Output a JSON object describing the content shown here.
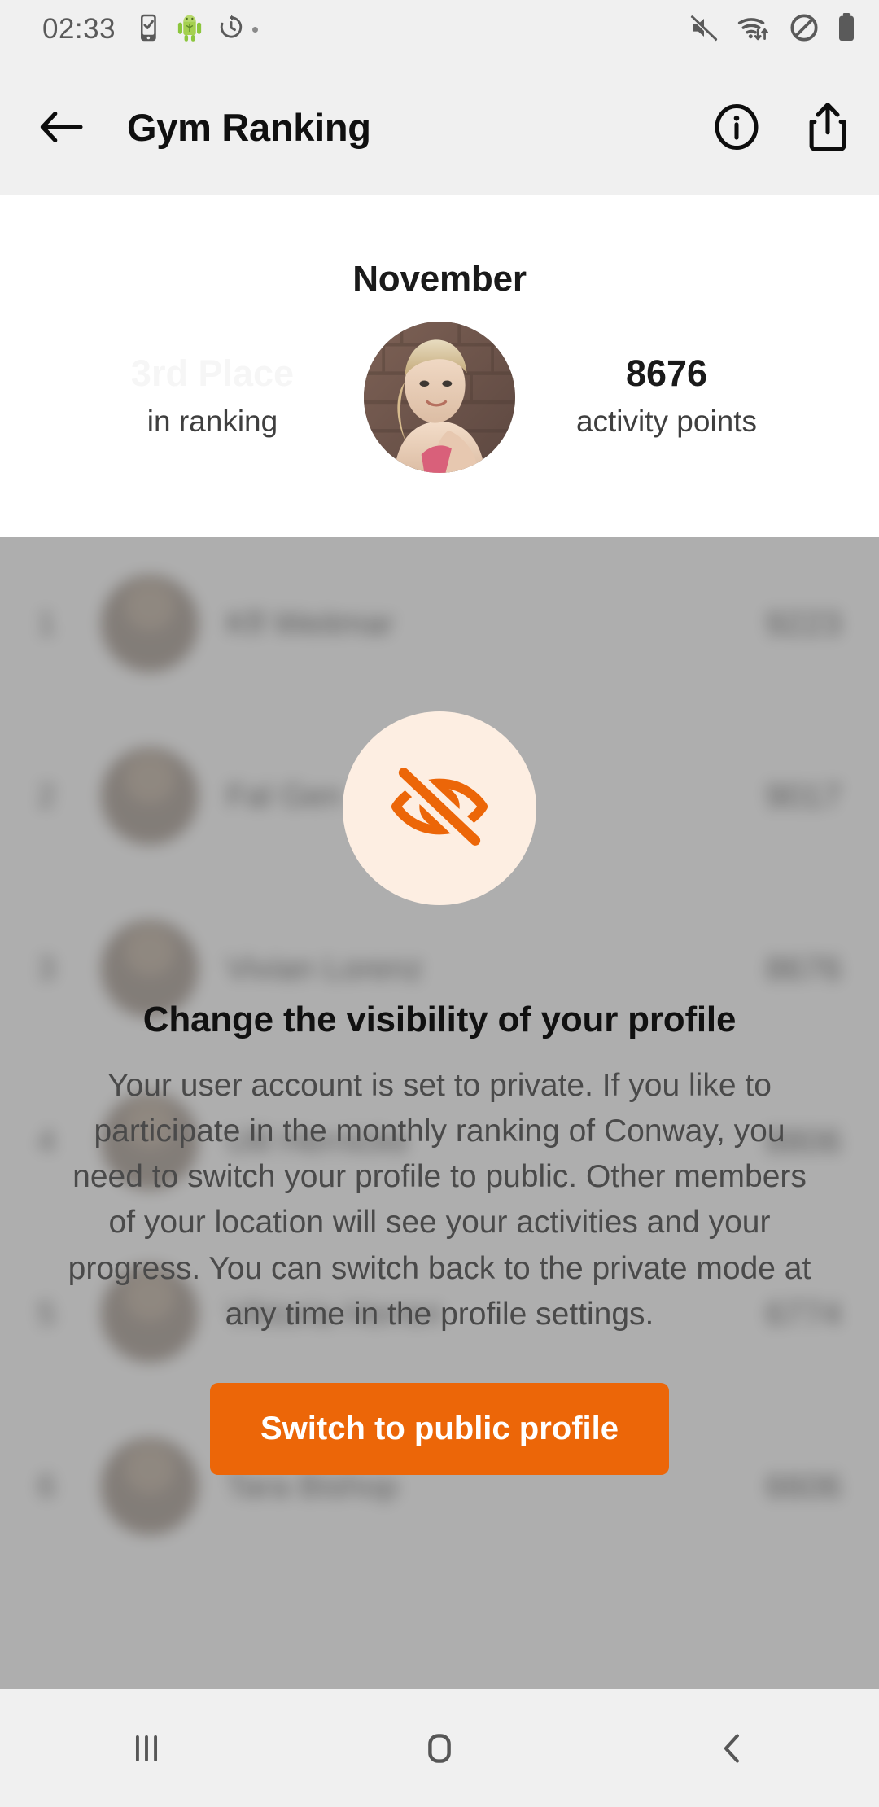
{
  "status_bar": {
    "time": "02:33",
    "left_icons": [
      "sim-card-check-icon",
      "android-figure-icon",
      "alarm-history-icon"
    ],
    "right_icons": [
      "mute-icon",
      "wifi-transfer-icon",
      "do-not-disturb-icon",
      "battery-icon"
    ],
    "background": "#f0f0f0"
  },
  "app_bar": {
    "back_icon": "arrow-left-icon",
    "title": "Gym Ranking",
    "info_icon": "info-circle-icon",
    "share_icon": "share-icon"
  },
  "summary": {
    "month": "November",
    "place_value": "3rd Place",
    "place_label": "in ranking",
    "avatar": "user-avatar-photo",
    "points_value": "8676",
    "points_label": "activity points"
  },
  "ranking": {
    "columns": [
      "rank",
      "avatar",
      "name",
      "points"
    ],
    "rows": [
      {
        "rank": "1",
        "name": "Kfl Weitmar",
        "points": "9223"
      },
      {
        "rank": "2",
        "name": "Fal Gen",
        "points": "9017"
      },
      {
        "rank": "3",
        "name": "Vivian Lorenz",
        "points": "8676"
      },
      {
        "rank": "4",
        "name": "Ulli Hernicke",
        "points": "8806"
      },
      {
        "rank": "5",
        "name": "Viktoria Herren",
        "points": "6774"
      },
      {
        "rank": "6",
        "name": "Tara Bishop",
        "points": "6606"
      }
    ]
  },
  "modal": {
    "icon": "eye-off-icon",
    "icon_color": "#ec6608",
    "icon_bg": "#fdeee2",
    "title": "Change the visibility of your profile",
    "body": "Your user account is set to private. If you like to participate in the monthly ranking of Conway, you need to switch your profile to public. Other members of your location will see your activities and your progress. You can switch back to the private mode at any time in the profile settings.",
    "button_label": "Switch to public profile",
    "button_color": "#ec6608"
  },
  "nav_bar": {
    "recents_icon": "recents-icon",
    "home_icon": "home-icon",
    "back_icon": "back-chevron-icon"
  }
}
